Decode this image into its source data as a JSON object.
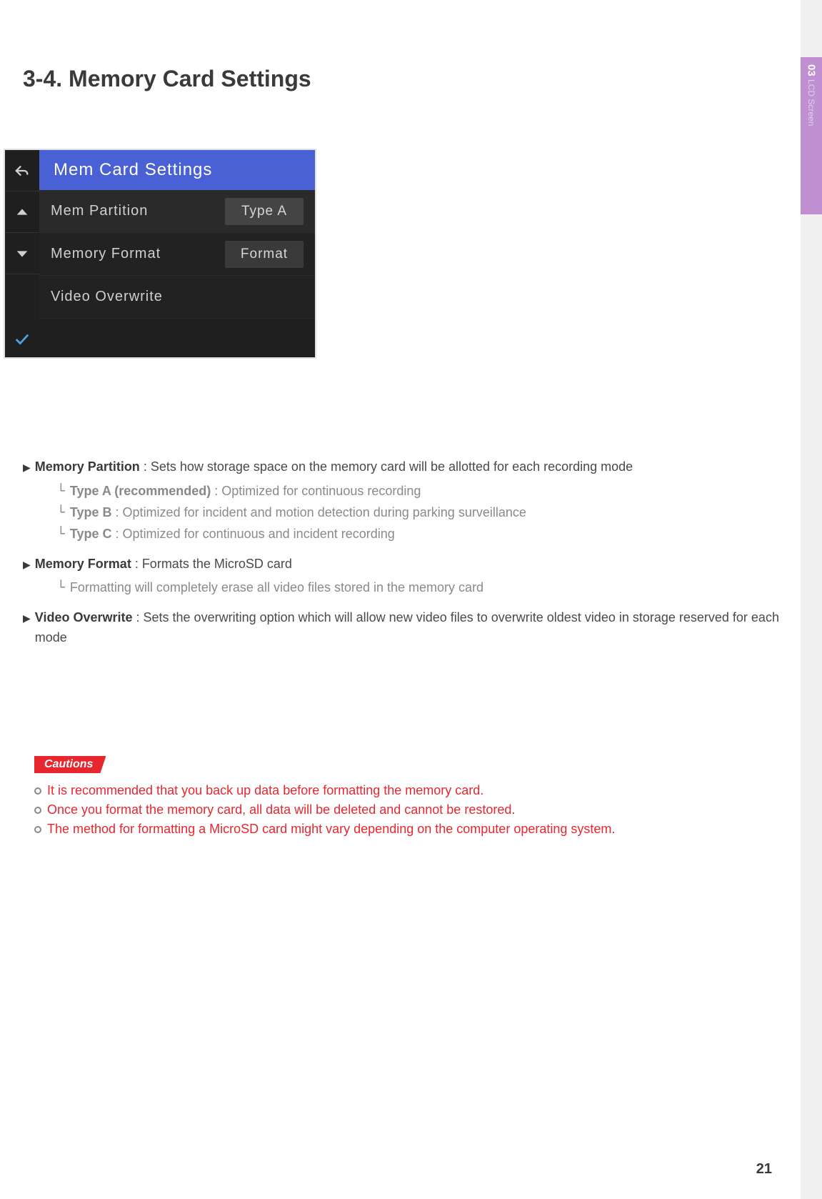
{
  "sideTab": {
    "number": "03",
    "label": "LCD Screen"
  },
  "pageTitle": "3-4. Memory Card Settings",
  "device": {
    "header": "Mem Card Settings",
    "rows": [
      {
        "label": "Mem Partition",
        "value": "Type A"
      },
      {
        "label": "Memory Format",
        "value": "Format"
      },
      {
        "label": "Video Overwrite",
        "value": ""
      }
    ]
  },
  "sections": {
    "memPartition": {
      "title": "Memory Partition",
      "desc": " : Sets how storage space on the memory card will be allotted for each recording mode",
      "subs": [
        {
          "title": "Type A (recommended)",
          "desc": " : Optimized for continuous recording"
        },
        {
          "title": "Type B",
          "desc": " : Optimized for incident and motion detection during parking surveillance"
        },
        {
          "title": "Type C",
          "desc": " : Optimized for continuous and incident recording"
        }
      ]
    },
    "memFormat": {
      "title": "Memory Format",
      "desc": " : Formats the MicroSD card",
      "sub": " Formatting will completely erase all video files stored in the memory card"
    },
    "videoOverwrite": {
      "title": "Video Overwrite",
      "desc": " : Sets the overwriting option which will allow new video files to overwrite oldest video in storage reserved for each mode"
    }
  },
  "cautions": {
    "label": "Cautions",
    "items": [
      "It is recommended that you back up data before formatting the memory card.",
      "Once you format the memory card, all data will be deleted and cannot be restored.",
      "The method for formatting a MicroSD card might vary depending on the computer operating system."
    ]
  },
  "pageNumber": "21"
}
